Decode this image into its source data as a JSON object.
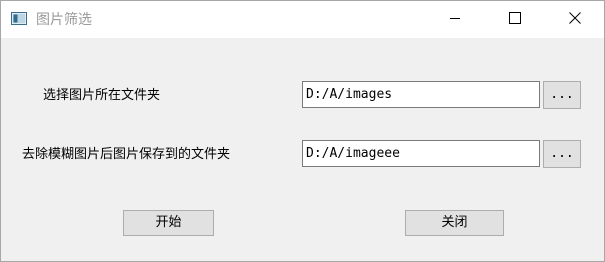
{
  "window": {
    "title": "图片筛选",
    "icon": "app-window-icon",
    "controls": [
      "minimize-icon",
      "maximize-icon",
      "close-icon"
    ]
  },
  "source_folder": {
    "label": "选择图片所在文件夹",
    "value": "D:/A/images",
    "browse_label": "..."
  },
  "output_folder": {
    "label": "去除模糊图片后图片保存到的文件夹",
    "value": "D:/A/imageee",
    "browse_label": "..."
  },
  "actions": {
    "start_label": "开始",
    "close_label": "关闭"
  }
}
